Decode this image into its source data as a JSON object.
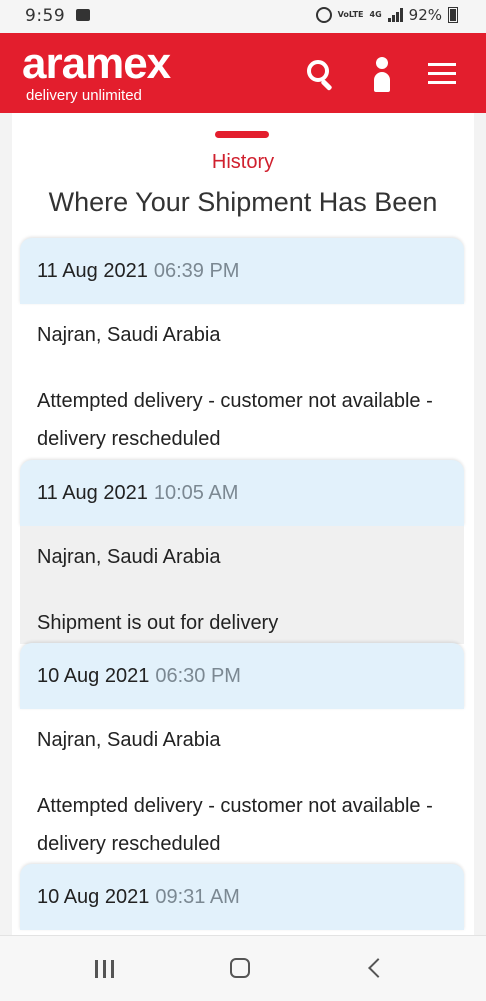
{
  "status_bar": {
    "time": "9:59",
    "network_tag": "VoLTE",
    "network_type": "4G",
    "battery": "92%"
  },
  "header": {
    "logo": "aramex",
    "tagline": "delivery unlimited",
    "icons": [
      "search-icon",
      "user-icon",
      "menu-icon"
    ],
    "colors": {
      "brand": "#e31e2d"
    }
  },
  "history": {
    "label": "History",
    "title": "Where Your Shipment Has Been",
    "entries": [
      {
        "date": "11 Aug 2021",
        "time": "06:39 PM",
        "location": "Najran, Saudi Arabia",
        "status": "Attempted delivery - customer not available - delivery rescheduled"
      },
      {
        "date": "11 Aug 2021",
        "time": "10:05 AM",
        "location": "Najran, Saudi Arabia",
        "status": "Shipment is out for delivery"
      },
      {
        "date": "10 Aug 2021",
        "time": "06:30 PM",
        "location": "Najran, Saudi Arabia",
        "status": "Attempted delivery - customer not available - delivery rescheduled"
      },
      {
        "date": "10 Aug 2021",
        "time": "09:31 AM",
        "location": "",
        "status": ""
      }
    ]
  },
  "nav": {
    "icons": [
      "recents-icon",
      "home-icon",
      "back-icon"
    ]
  }
}
